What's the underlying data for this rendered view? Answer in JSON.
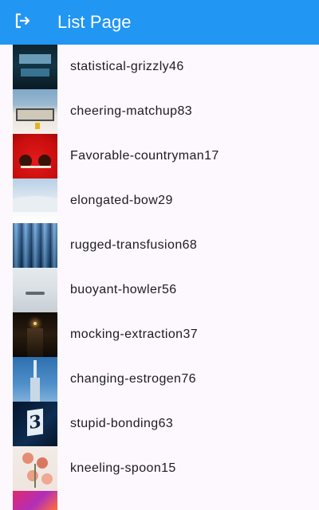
{
  "app_bar": {
    "title": "List Page",
    "background": "#2196f3",
    "leading_icon": "logout-icon"
  },
  "list": {
    "items": [
      {
        "label": "statistical-grizzly46"
      },
      {
        "label": "cheering-matchup83"
      },
      {
        "label": "Favorable-countryman17"
      },
      {
        "label": "elongated-bow29"
      },
      {
        "label": "rugged-transfusion68"
      },
      {
        "label": "buoyant-howler56"
      },
      {
        "label": "mocking-extraction37"
      },
      {
        "label": "changing-estrogen76"
      },
      {
        "label": "stupid-bonding63"
      },
      {
        "label": "kneeling-spoon15"
      },
      {
        "label": ""
      }
    ]
  }
}
